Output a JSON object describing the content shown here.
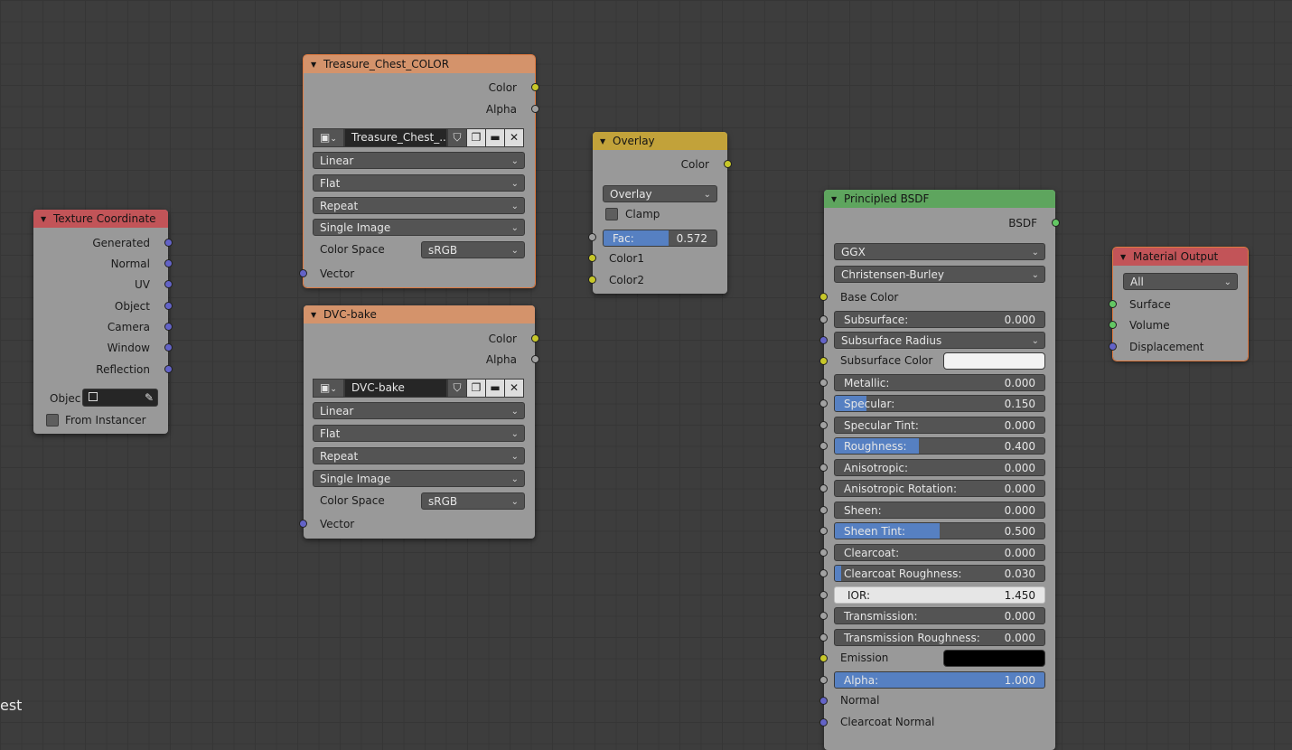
{
  "background_text": "est",
  "texture_coordinate": {
    "title": "Texture Coordinate",
    "outputs": [
      "Generated",
      "Normal",
      "UV",
      "Object",
      "Camera",
      "Window",
      "Reflection"
    ],
    "object_label": "Objec",
    "from_instancer": "From Instancer"
  },
  "image_node_1": {
    "title": "Treasure_Chest_COLOR",
    "out_color": "Color",
    "out_alpha": "Alpha",
    "image_name": "Treasure_Chest_..",
    "interpolation": "Linear",
    "projection": "Flat",
    "extension": "Repeat",
    "source": "Single Image",
    "color_space_label": "Color Space",
    "color_space": "sRGB",
    "in_vector": "Vector"
  },
  "image_node_2": {
    "title": "DVC-bake",
    "out_color": "Color",
    "out_alpha": "Alpha",
    "image_name": "DVC-bake",
    "interpolation": "Linear",
    "projection": "Flat",
    "extension": "Repeat",
    "source": "Single Image",
    "color_space_label": "Color Space",
    "color_space": "sRGB",
    "in_vector": "Vector"
  },
  "overlay_node": {
    "title": "Overlay",
    "out_color": "Color",
    "blend_mode": "Overlay",
    "clamp": "Clamp",
    "fac_label": "Fac:",
    "fac_value": "0.572",
    "fac_fraction": 0.572,
    "color1": "Color1",
    "color2": "Color2"
  },
  "bsdf_node": {
    "title": "Principled BSDF",
    "out": "BSDF",
    "distribution": "GGX",
    "subsurface_method": "Christensen-Burley",
    "base_color": "Base Color",
    "subsurface_radius": "Subsurface Radius",
    "subsurface_color": "Subsurface Color",
    "emission": "Emission",
    "normal": "Normal",
    "clearcoat_normal": "Clearcoat Normal",
    "fields": {
      "subsurface": {
        "label": "Subsurface:",
        "value": "0.000",
        "fill": 0.0
      },
      "metallic": {
        "label": "Metallic:",
        "value": "0.000",
        "fill": 0.0
      },
      "specular": {
        "label": "Specular:",
        "value": "0.150",
        "fill": 0.15
      },
      "specular_tint": {
        "label": "Specular Tint:",
        "value": "0.000",
        "fill": 0.0
      },
      "roughness": {
        "label": "Roughness:",
        "value": "0.400",
        "fill": 0.4
      },
      "anisotropic": {
        "label": "Anisotropic:",
        "value": "0.000",
        "fill": 0.0
      },
      "anisotropic_rotation": {
        "label": "Anisotropic Rotation:",
        "value": "0.000",
        "fill": 0.0
      },
      "sheen": {
        "label": "Sheen:",
        "value": "0.000",
        "fill": 0.0
      },
      "sheen_tint": {
        "label": "Sheen Tint:",
        "value": "0.500",
        "fill": 0.5
      },
      "clearcoat": {
        "label": "Clearcoat:",
        "value": "0.000",
        "fill": 0.0
      },
      "clearcoat_roughness": {
        "label": "Clearcoat Roughness:",
        "value": "0.030",
        "fill": 0.03
      },
      "ior": {
        "label": "IOR:",
        "value": "1.450"
      },
      "transmission": {
        "label": "Transmission:",
        "value": "0.000",
        "fill": 0.0
      },
      "transmission_roughness": {
        "label": "Transmission Roughness:",
        "value": "0.000",
        "fill": 0.0
      },
      "alpha": {
        "label": "Alpha:",
        "value": "1.000",
        "fill": 1.0
      }
    }
  },
  "material_output": {
    "title": "Material Output",
    "target": "All",
    "surface": "Surface",
    "volume": "Volume",
    "displacement": "Displacement"
  },
  "colors": {
    "accent_blue": "#5680c2",
    "header_input": "#c25458",
    "header_texture": "#d4936b",
    "header_color": "#c2a23a",
    "header_shader": "#5ea55e",
    "socket_color": "#c7c729",
    "socket_float": "#a1a1a1",
    "socket_vector": "#6363c7",
    "socket_shader": "#63c763"
  }
}
